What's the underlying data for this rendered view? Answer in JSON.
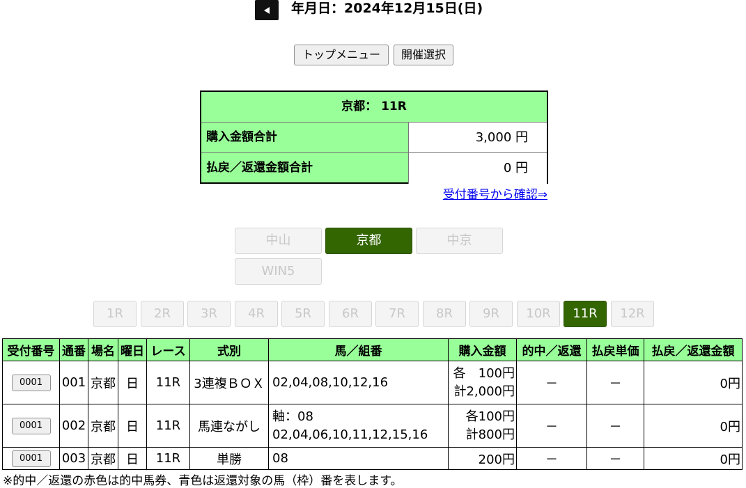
{
  "header": {
    "date_text": "年月日：2024年12月15日(日)"
  },
  "top_buttons": {
    "top_menu": "トップメニュー",
    "select_meeting": "開催選択"
  },
  "summary": {
    "title": "京都： 11R",
    "rows": [
      {
        "label": "購入金額合計",
        "value": "3,000 円"
      },
      {
        "label": "払戻／返還金額合計",
        "value": "0 円"
      }
    ]
  },
  "confirm_link": "受付番号から確認⇒",
  "venues": [
    {
      "label": "中山",
      "active": false
    },
    {
      "label": "京都",
      "active": true
    },
    {
      "label": "中京",
      "active": false
    },
    {
      "label": "WIN5",
      "active": false
    }
  ],
  "races": [
    "1R",
    "2R",
    "3R",
    "4R",
    "5R",
    "6R",
    "7R",
    "8R",
    "9R",
    "10R",
    "11R",
    "12R"
  ],
  "active_race": "11R",
  "table": {
    "headers": [
      "受付番号",
      "通番",
      "場名",
      "曜日",
      "レース",
      "式別",
      "馬／組番",
      "購入金額",
      "的中／返還",
      "払戻単価",
      "払戻／返還金額"
    ],
    "rows": [
      {
        "receipt": "0001",
        "serial": "001",
        "venue": "京都",
        "day": "日",
        "race": "11R",
        "bet_type": "3連複ＢＯＸ",
        "combo": [
          "02,04,08,10,12,16"
        ],
        "amount": [
          "各　100円",
          "計2,000円"
        ],
        "hit": "－",
        "unit_payout": "－",
        "payout": "0円"
      },
      {
        "receipt": "0001",
        "serial": "002",
        "venue": "京都",
        "day": "日",
        "race": "11R",
        "bet_type": "馬連ながし",
        "combo": [
          "軸：08",
          "02,04,06,10,11,12,15,16"
        ],
        "amount": [
          "各100円",
          "計800円"
        ],
        "hit": "－",
        "unit_payout": "－",
        "payout": "0円"
      },
      {
        "receipt": "0001",
        "serial": "003",
        "venue": "京都",
        "day": "日",
        "race": "11R",
        "bet_type": "単勝",
        "combo": [
          "08"
        ],
        "amount": [
          "200円"
        ],
        "hit": "－",
        "unit_payout": "－",
        "payout": "0円"
      }
    ]
  },
  "footnote": "※的中／返還の赤色は的中馬券、青色は返還対象の馬（枠）番を表します。"
}
